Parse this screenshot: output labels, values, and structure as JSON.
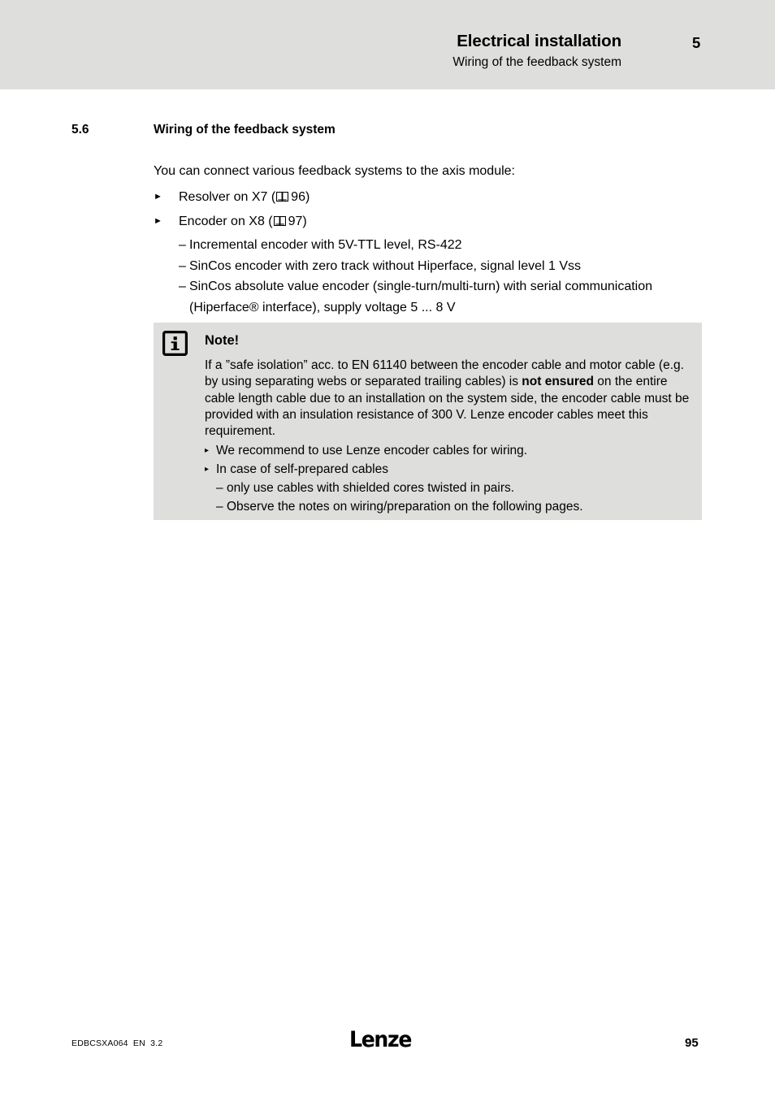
{
  "header": {
    "title": "Electrical installation",
    "subtitle": "Wiring of the feedback system",
    "chapter": "5"
  },
  "section": {
    "number": "5.6",
    "title": "Wiring of the feedback system"
  },
  "content": {
    "intro": "You can connect various feedback systems to the axis module:",
    "bullets": [
      {
        "marker": "►",
        "text_before": "Resolver on X7 (",
        "icon": "book-icon",
        "page_ref": "96",
        "text_after": ")",
        "sub_items": []
      },
      {
        "marker": "►",
        "text_before": "Encoder on X8 (",
        "icon": "book-icon",
        "page_ref": "97",
        "text_after": ")",
        "sub_items": [
          {
            "marker": "–",
            "text": "Incremental encoder with 5V-TTL level, RS-422"
          },
          {
            "marker": "–",
            "text": "SinCos encoder with zero track without Hiperface, signal level 1 Vss"
          },
          {
            "marker": "–",
            "text": "SinCos absolute value encoder (single-turn/multi-turn) with serial communication (Hiperface® interface), supply voltage 5 ... 8 V"
          }
        ]
      }
    ]
  },
  "note": {
    "icon": "info-icon",
    "title": "Note!",
    "body_part1": "If a ”safe isolation” acc. to EN 61140 between the encoder cable and motor cable (e.g. by using separating webs or separated trailing cables) is ",
    "body_bold": "not ensured",
    "body_part2": " on the entire cable length cable due to an installation on the system side, the encoder cable must be provided with an insulation resistance of 300 V. Lenze encoder cables meet this requirement.",
    "bullets": [
      {
        "marker": "▸",
        "text": "We recommend to use Lenze encoder cables for wiring.",
        "sub_items": []
      },
      {
        "marker": "▸",
        "text": "In case of self-prepared cables",
        "sub_items": [
          {
            "marker": "–",
            "text": "only use cables with shielded cores twisted in pairs."
          },
          {
            "marker": "–",
            "text": "Observe the notes on wiring/preparation on the following pages."
          }
        ]
      }
    ]
  },
  "footer": {
    "doc_id": "EDBCSXA064  EN  3.2",
    "logo": "Lenze",
    "page_number": "95"
  },
  "colors": {
    "band_gray": "#dededd",
    "text": "#000000",
    "page_bg": "#ffffff"
  }
}
